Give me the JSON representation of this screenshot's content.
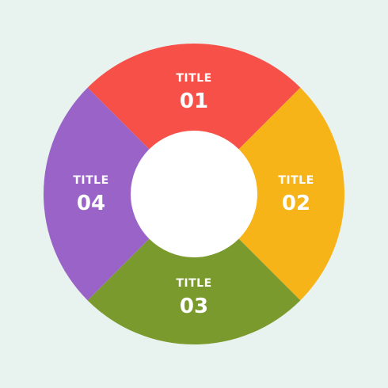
{
  "diagram": {
    "background": "#e8f2ef",
    "hole_color": "#ffffff",
    "segments": [
      {
        "title": "TITLE",
        "number": "01",
        "color": "#f75048",
        "position": "top"
      },
      {
        "title": "TITLE",
        "number": "02",
        "color": "#f6b419",
        "position": "right"
      },
      {
        "title": "TITLE",
        "number": "03",
        "color": "#7a9a2e",
        "position": "bottom"
      },
      {
        "title": "TITLE",
        "number": "04",
        "color": "#9a63c8",
        "position": "left"
      }
    ]
  }
}
